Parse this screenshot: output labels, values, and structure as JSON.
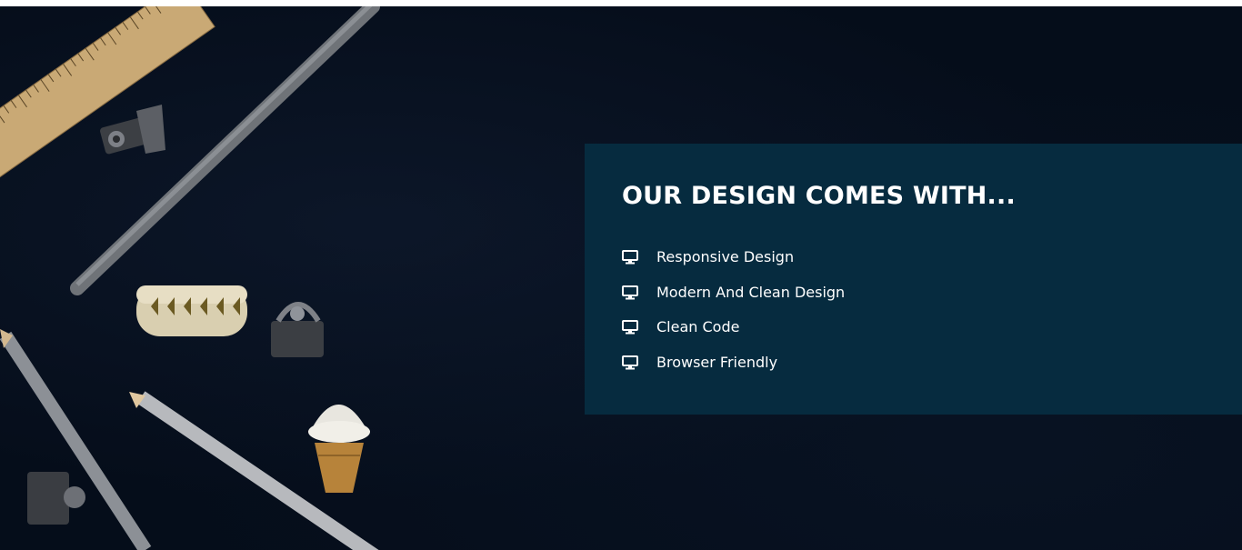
{
  "section": {
    "title": "OUR DESIGN COMES WITH...",
    "features": [
      {
        "label": "Responsive Design",
        "icon": "monitor-icon"
      },
      {
        "label": "Modern And Clean Design",
        "icon": "monitor-icon"
      },
      {
        "label": "Clean Code",
        "icon": "monitor-icon"
      },
      {
        "label": "Browser Friendly",
        "icon": "monitor-icon"
      }
    ]
  },
  "colors": {
    "background": "#050d1a",
    "panel": "#062b3f",
    "text": "#ffffff"
  }
}
